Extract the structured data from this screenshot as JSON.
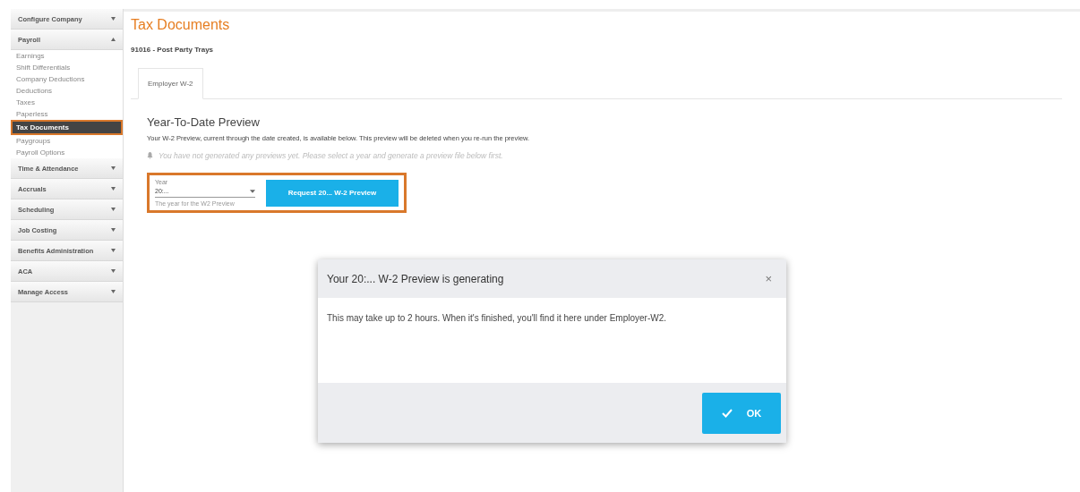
{
  "sidebar": {
    "sections": [
      {
        "label": "Configure Company",
        "expanded": false
      },
      {
        "label": "Payroll",
        "expanded": true,
        "items": [
          {
            "label": "Earnings",
            "selected": false
          },
          {
            "label": "Shift Differentials",
            "selected": false
          },
          {
            "label": "Company Deductions",
            "selected": false
          },
          {
            "label": "Deductions",
            "selected": false
          },
          {
            "label": "Taxes",
            "selected": false
          },
          {
            "label": "Paperless",
            "selected": false
          },
          {
            "label": "Tax Documents",
            "selected": true,
            "highlighted": true
          },
          {
            "label": "Paygroups",
            "selected": false
          },
          {
            "label": "Payroll Options",
            "selected": false
          }
        ]
      },
      {
        "label": "Time & Attendance",
        "expanded": false
      },
      {
        "label": "Accruals",
        "expanded": false
      },
      {
        "label": "Scheduling",
        "expanded": false
      },
      {
        "label": "Job Costing",
        "expanded": false
      },
      {
        "label": "Benefits Administration",
        "expanded": false
      },
      {
        "label": "ACA",
        "expanded": false
      },
      {
        "label": "Manage Access",
        "expanded": false
      }
    ]
  },
  "page": {
    "title": "Tax Documents",
    "company": "91016 - Post Party Trays"
  },
  "tabs": [
    {
      "label": "Employer W-2",
      "selected": true
    }
  ],
  "preview": {
    "heading": "Year-To-Date Preview",
    "description": "Your W-2 Preview, current through the date created, is available below. This preview will be deleted when you re-run the preview.",
    "notice": "You have not generated any previews yet. Please select a year and generate a preview file below first.",
    "highlighted": true,
    "year_field": {
      "label": "Year",
      "value": "20:...",
      "helper": "The year for the W2 Preview"
    },
    "request_button": "Request 20... W-2 Preview"
  },
  "dialog": {
    "title": "Your 20:... W-2 Preview is generating",
    "close": "×",
    "message": "This may take up to 2 hours. When it's finished, you'll find it here under Employer-W2.",
    "ok_button": "OK"
  }
}
